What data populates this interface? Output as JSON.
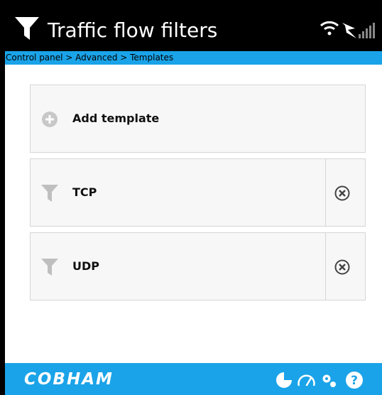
{
  "header": {
    "title": "Traffic flow filters"
  },
  "breadcrumb": "Control panel > Advanced > Templates",
  "add_template": {
    "label": "Add template"
  },
  "templates": [
    {
      "label": "TCP"
    },
    {
      "label": "UDP"
    }
  ],
  "footer": {
    "logo": "COBHAM"
  },
  "colors": {
    "header_bg": "#000000",
    "accent": "#1aa3e8",
    "card_bg": "#f7f7f7"
  }
}
